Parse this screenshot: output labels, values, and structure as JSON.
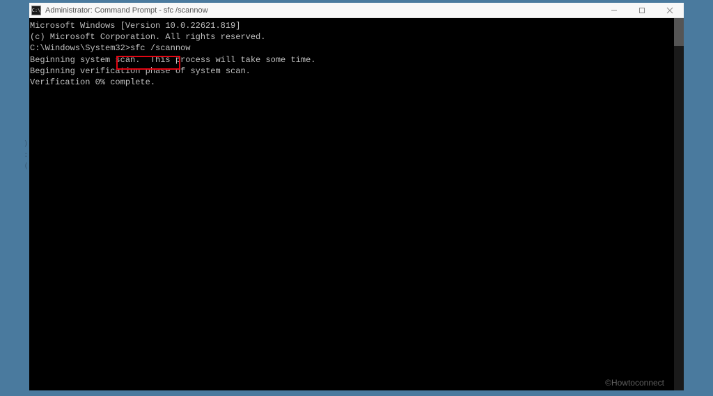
{
  "window": {
    "title": "Administrator: Command Prompt - sfc  /scannow",
    "icon_label": "C:\\"
  },
  "terminal": {
    "lines": [
      "Microsoft Windows [Version 10.0.22621.819]",
      "(c) Microsoft Corporation. All rights reserved.",
      "",
      "C:\\Windows\\System32>sfc /scannow",
      "",
      "Beginning system scan.  This process will take some time.",
      "",
      "Beginning verification phase of system scan.",
      "Verification 0% complete."
    ]
  },
  "highlight": {
    "command": "sfc /scannow"
  },
  "watermark": "©Howtoconnect",
  "artifacts": {
    "a1": ")",
    "a2": ":",
    "a3": "("
  }
}
